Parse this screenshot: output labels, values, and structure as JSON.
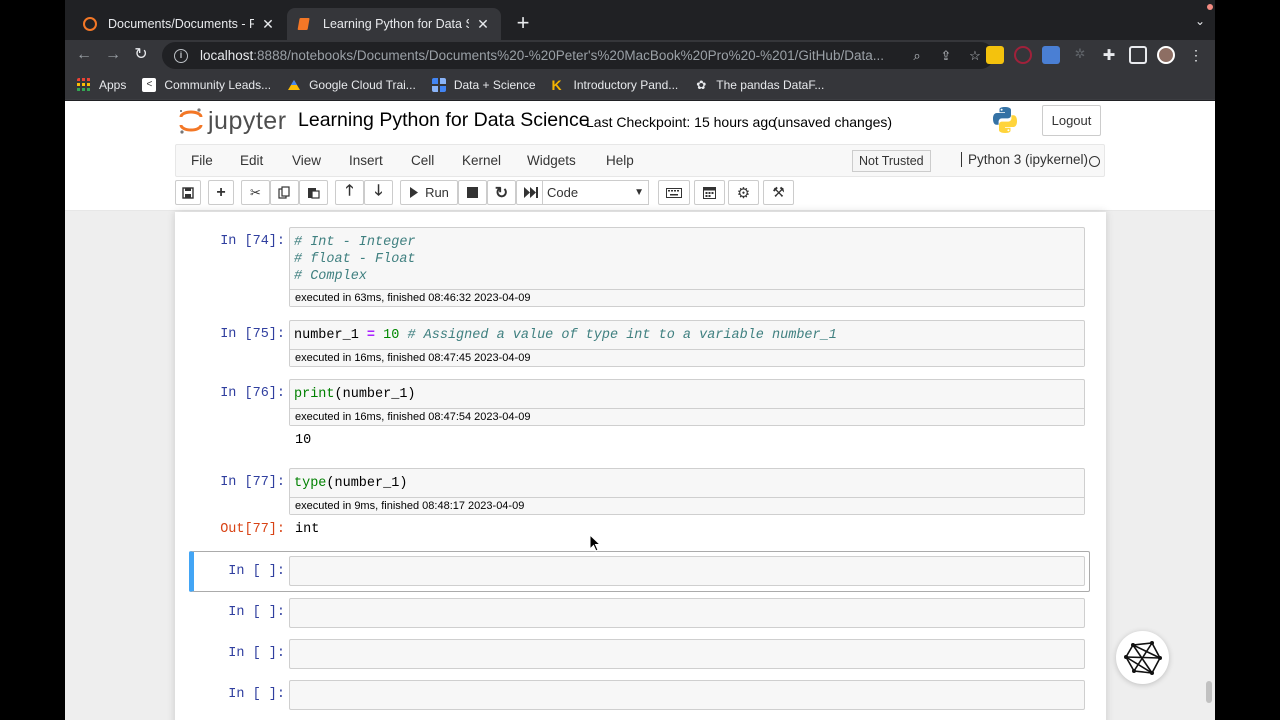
{
  "browser": {
    "tabs": [
      {
        "title": "Documents/Documents - Peter's",
        "active": false
      },
      {
        "title": "Learning Python for Data Scien",
        "active": true
      }
    ],
    "url_host": "localhost",
    "url_path": ":8888/notebooks/Documents/Documents%20-%20Peter's%20MacBook%20Pro%20-%201/GitHub/Data...",
    "bookmarks": [
      {
        "label": "Apps",
        "icon": "apps-grid-icon"
      },
      {
        "label": "Community Leads...",
        "icon": "community-icon"
      },
      {
        "label": "Google Cloud Trai...",
        "icon": "google-cloud-icon"
      },
      {
        "label": "Data + Science",
        "icon": "data-science-icon"
      },
      {
        "label": "Introductory Pand...",
        "icon": "k-icon"
      },
      {
        "label": "The pandas DataF...",
        "icon": "pandas-icon"
      }
    ]
  },
  "jupyter": {
    "logo_text": "jupyter",
    "notebook_name": "Learning Python for Data Science",
    "checkpoint": "Last Checkpoint: 15 hours ago",
    "unsaved": "(unsaved changes)",
    "logout": "Logout",
    "menu": [
      "File",
      "Edit",
      "View",
      "Insert",
      "Cell",
      "Kernel",
      "Widgets",
      "Help"
    ],
    "not_trusted": "Not Trusted",
    "kernel_name": "Python 3 (ipykernel)",
    "run_label": "Run",
    "cell_type": "Code"
  },
  "cells": {
    "c74": {
      "prompt": "In [74]:",
      "lines": [
        "# Int - Integer",
        "# float - Float",
        "# Complex"
      ],
      "exec": "executed in 63ms, finished 08:46:32 2023-04-09"
    },
    "c75": {
      "prompt": "In [75]:",
      "var": "number_1",
      "op": "=",
      "num": "10",
      "comment": "# Assigned a value of type int to a variable number_1",
      "exec": "executed in 16ms, finished 08:47:45 2023-04-09"
    },
    "c76": {
      "prompt": "In [76]:",
      "fn": "print",
      "arg": "(number_1)",
      "exec": "executed in 16ms, finished 08:47:54 2023-04-09",
      "output": "10"
    },
    "c77": {
      "prompt": "In [77]:",
      "fn": "type",
      "arg": "(number_1)",
      "exec": "executed in 9ms, finished 08:48:17 2023-04-09",
      "out_prompt": "Out[77]:",
      "output": "int"
    },
    "empty_prompt": "In [ ]:"
  }
}
